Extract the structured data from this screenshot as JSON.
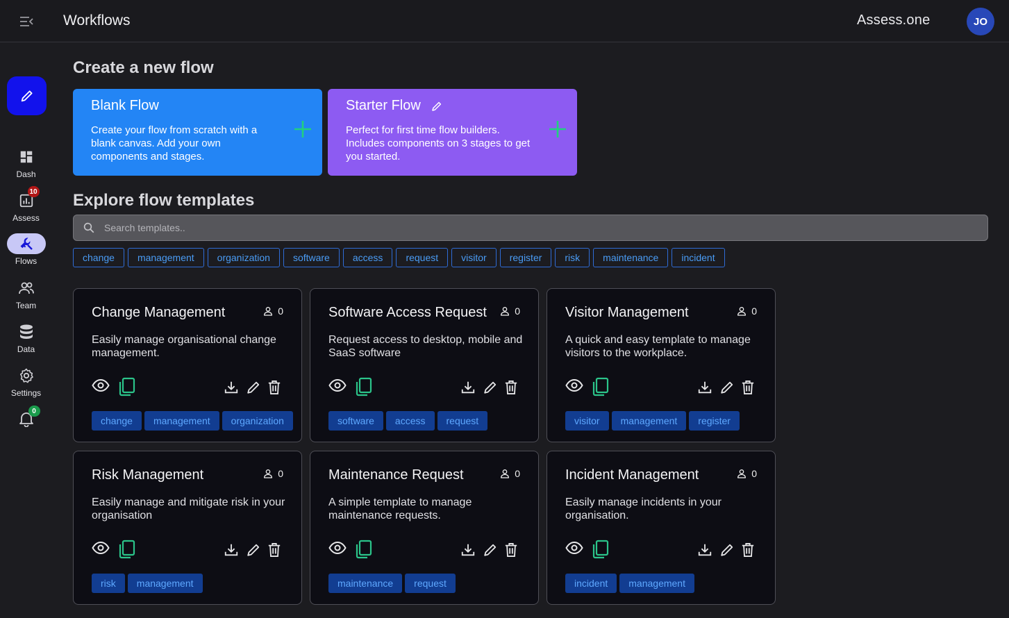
{
  "header": {
    "title": "Workflows",
    "brand": "Assess.one",
    "avatar_initials": "JO"
  },
  "sidebar": {
    "fab_icon": "pencil-icon",
    "items": [
      {
        "label": "Dash",
        "icon": "dashboard-icon",
        "active": false
      },
      {
        "label": "Assess",
        "icon": "chart-icon",
        "badge": "10",
        "active": false
      },
      {
        "label": "Flows",
        "icon": "wrench-icon",
        "active": true
      },
      {
        "label": "Team",
        "icon": "people-icon",
        "active": false
      },
      {
        "label": "Data",
        "icon": "database-icon",
        "active": false
      },
      {
        "label": "Settings",
        "icon": "gear-icon",
        "active": false
      }
    ],
    "notifications": {
      "icon": "bell-icon",
      "badge": "0"
    }
  },
  "create": {
    "title": "Create a new flow",
    "blank": {
      "title": "Blank Flow",
      "description": "Create your flow from scratch with a blank canvas. Add your own components and stages."
    },
    "starter": {
      "title": "Starter Flow",
      "description": "Perfect for first time flow builders. Includes components on 3 stages to get you started."
    }
  },
  "explore": {
    "title": "Explore flow templates",
    "search_placeholder": "Search templates..",
    "filters": [
      "change",
      "management",
      "organization",
      "software",
      "access",
      "request",
      "visitor",
      "register",
      "risk",
      "maintenance",
      "incident"
    ]
  },
  "templates": [
    {
      "title": "Change Management",
      "users": "0",
      "description": "Easily manage organisational change management.",
      "tags": [
        "change",
        "management",
        "organization"
      ]
    },
    {
      "title": "Software Access Request",
      "users": "0",
      "description": "Request access to desktop, mobile and SaaS software",
      "tags": [
        "software",
        "access",
        "request"
      ]
    },
    {
      "title": "Visitor Management",
      "users": "0",
      "description": "A quick and easy template to manage visitors to the workplace.",
      "tags": [
        "visitor",
        "management",
        "register"
      ]
    },
    {
      "title": "Risk Management",
      "users": "0",
      "description": "Easily manage and mitigate risk in your organisation",
      "tags": [
        "risk",
        "management"
      ]
    },
    {
      "title": "Maintenance Request",
      "users": "0",
      "description": "A simple template to manage maintenance requests.",
      "tags": [
        "maintenance",
        "request"
      ]
    },
    {
      "title": "Incident Management",
      "users": "0",
      "description": "Easily manage incidents in your organisation.",
      "tags": [
        "incident",
        "management"
      ]
    }
  ],
  "colors": {
    "accent_blue": "#2385f5",
    "accent_purple": "#8d5bf2",
    "copy_green": "#2bc48a",
    "fab": "#1212ec"
  }
}
